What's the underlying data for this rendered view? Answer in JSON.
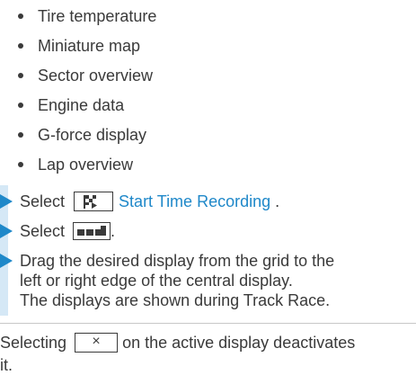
{
  "bullets": [
    "Tire temperature",
    "Miniature map",
    "Sector overview",
    "Engine data",
    "G-force display",
    "Lap overview"
  ],
  "steps": [
    {
      "prefix": "Select",
      "icon": "checkered-flag-icon",
      "link": "Start Time Recording",
      "suffix": "."
    },
    {
      "prefix": "Select",
      "icon": "display-layout-icon",
      "suffix": "."
    },
    {
      "lines": [
        "Drag the desired display from the grid to the",
        "left or right edge of the central display.",
        "The displays are shown during Track Race."
      ]
    }
  ],
  "note": {
    "before": "Selecting",
    "icon": "close-icon",
    "icon_glyph": "×",
    "after": "on the active display deactivates",
    "wrap": "it."
  },
  "colors": {
    "accent": "#1f88c9",
    "bar": "#d5e8f6",
    "text": "#3a3a3a"
  }
}
